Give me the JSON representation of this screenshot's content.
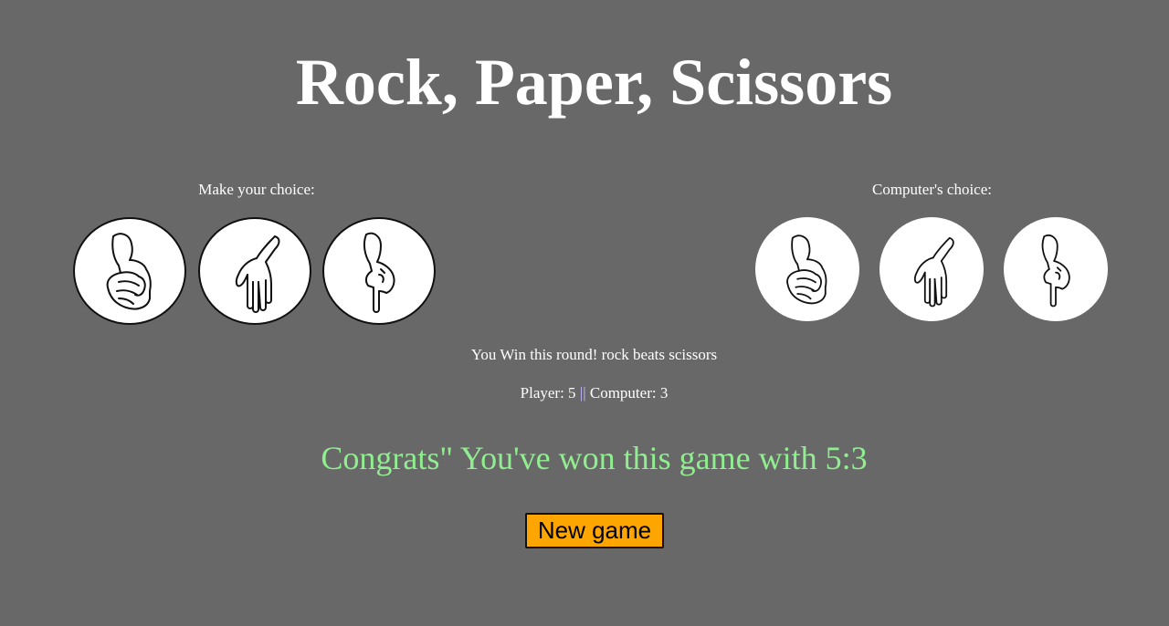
{
  "title": "Rock, Paper, Scissors",
  "player": {
    "label": "Make your choice:",
    "choices": [
      {
        "name": "rock",
        "icon": "fist-hand-icon"
      },
      {
        "name": "paper",
        "icon": "open-hand-icon"
      },
      {
        "name": "scissors",
        "icon": "pointing-hand-icon"
      }
    ]
  },
  "computer": {
    "label": "Computer's choice:",
    "choices": [
      {
        "name": "rock",
        "icon": "fist-hand-icon"
      },
      {
        "name": "paper",
        "icon": "open-hand-icon"
      },
      {
        "name": "scissors",
        "icon": "pointing-hand-icon"
      }
    ]
  },
  "round_message": "You Win this round! rock beats scissors",
  "score": {
    "player_text": "Player: 5",
    "separator": "||",
    "computer_text": "Computer: 3"
  },
  "final_message": "Congrats\" You've won this game with 5:3",
  "new_game_label": "New game",
  "colors": {
    "background": "#686868",
    "win_text": "#90ee90",
    "button_bg": "#ffa500"
  }
}
